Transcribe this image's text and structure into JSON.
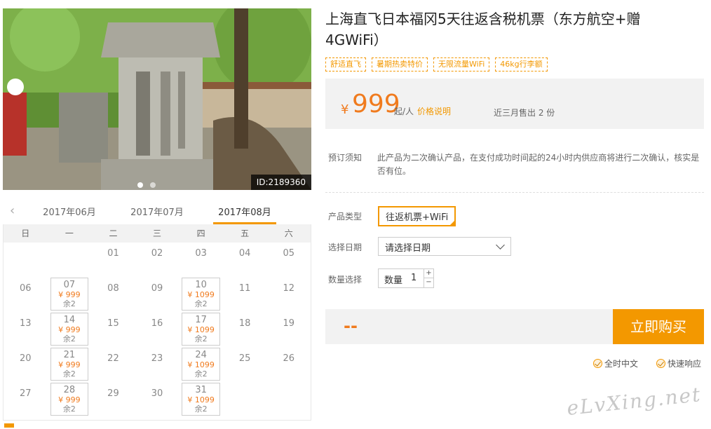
{
  "photo": {
    "id_badge": "ID:2189360",
    "dots": 2
  },
  "months": {
    "tabs": [
      {
        "label": "2017年06月",
        "active": false
      },
      {
        "label": "2017年07月",
        "active": false
      },
      {
        "label": "2017年08月",
        "active": true
      }
    ],
    "accent": "#f39800"
  },
  "calendar": {
    "weekdays": [
      "日",
      "一",
      "二",
      "三",
      "四",
      "五",
      "六"
    ],
    "weeks": [
      [
        null,
        null,
        {
          "day": "01"
        },
        {
          "day": "02"
        },
        {
          "day": "03"
        },
        {
          "day": "04"
        },
        {
          "day": "05"
        }
      ],
      [
        {
          "day": "06"
        },
        {
          "day": "07",
          "price": "¥ 999",
          "stock": "余2"
        },
        {
          "day": "08"
        },
        {
          "day": "09"
        },
        {
          "day": "10",
          "price": "¥ 1099",
          "stock": "余2"
        },
        {
          "day": "11"
        },
        {
          "day": "12"
        }
      ],
      [
        {
          "day": "13"
        },
        {
          "day": "14",
          "price": "¥ 999",
          "stock": "余2"
        },
        {
          "day": "15"
        },
        {
          "day": "16"
        },
        {
          "day": "17",
          "price": "¥ 1099",
          "stock": "余2"
        },
        {
          "day": "18"
        },
        {
          "day": "19"
        }
      ],
      [
        {
          "day": "20"
        },
        {
          "day": "21",
          "price": "¥ 999",
          "stock": "余2"
        },
        {
          "day": "22"
        },
        {
          "day": "23"
        },
        {
          "day": "24",
          "price": "¥ 1099",
          "stock": "余2"
        },
        {
          "day": "25"
        },
        {
          "day": "26"
        }
      ],
      [
        {
          "day": "27"
        },
        {
          "day": "28",
          "price": "¥ 999",
          "stock": "余2"
        },
        {
          "day": "29"
        },
        {
          "day": "30"
        },
        {
          "day": "31",
          "price": "¥ 1099",
          "stock": "余2"
        },
        null,
        null
      ]
    ]
  },
  "product": {
    "title": "上海直飞日本福冈5天往返含税机票（东方航空+赠4GWiFi）",
    "tags": [
      "舒适直飞",
      "暑期热卖特价",
      "无限流量WiFi",
      "46kg行李额"
    ],
    "price": {
      "currency": "¥",
      "value": "999",
      "unit": "起/人",
      "note_link": "价格说明",
      "sold": "近三月售出 2 份"
    },
    "notice": {
      "label": "预订须知",
      "text": "此产品为二次确认产品，在支付成功时间起的24小时内供应商将进行二次确认，核实是否有位。"
    },
    "type": {
      "label": "产品类型",
      "value": "往返机票+WiFi"
    },
    "date": {
      "label": "选择日期",
      "placeholder": "请选择日期"
    },
    "quantity": {
      "label": "数量选择",
      "field_label": "数量",
      "value": "1",
      "plus": "+",
      "minus": "−"
    },
    "total": "--",
    "buy_label": "立即购买",
    "badges": [
      "全时中文",
      "快速响应"
    ]
  },
  "watermark": "eLvXing.net",
  "colors": {
    "orange": "#f39800",
    "price": "#f07b1e",
    "panel": "#f2f2f2"
  }
}
